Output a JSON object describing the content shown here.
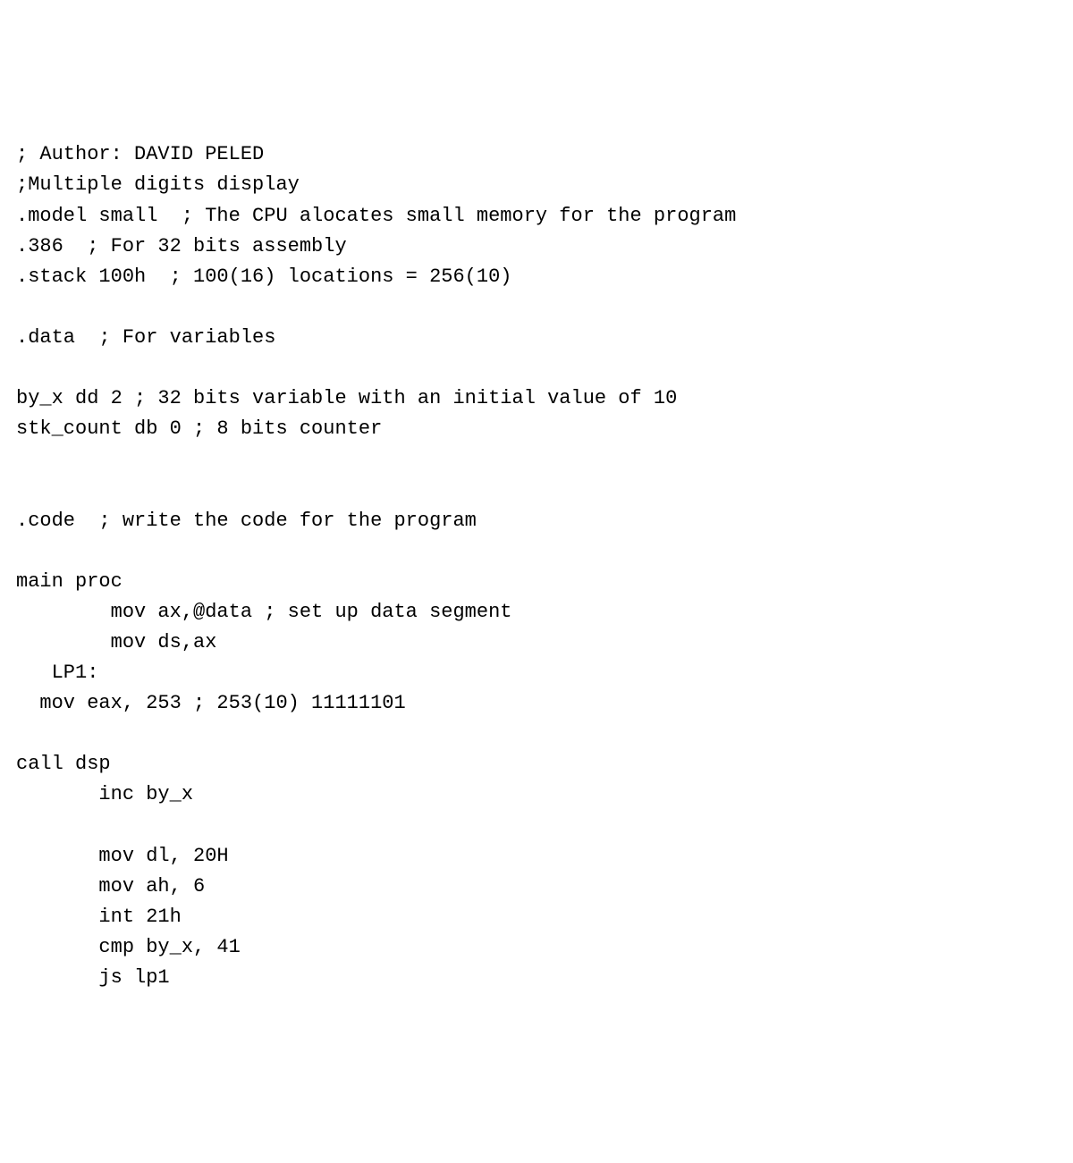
{
  "code": {
    "lines": [
      "; Author: DAVID PELED",
      ";Multiple digits display",
      ".model small  ; The CPU alocates small memory for the program",
      ".386  ; For 32 bits assembly",
      ".stack 100h  ; 100(16) locations = 256(10)",
      "",
      ".data  ; For variables",
      "",
      "by_x dd 2 ; 32 bits variable with an initial value of 10",
      "stk_count db 0 ; 8 bits counter",
      "",
      "",
      ".code  ; write the code for the program",
      "",
      "main proc",
      "        mov ax,@data ; set up data segment",
      "        mov ds,ax",
      "   LP1:",
      "  mov eax, 253 ; 253(10) 11111101",
      "",
      "call dsp",
      "       inc by_x",
      "",
      "       mov dl, 20H",
      "       mov ah, 6",
      "       int 21h",
      "       cmp by_x, 41",
      "       js lp1"
    ]
  }
}
